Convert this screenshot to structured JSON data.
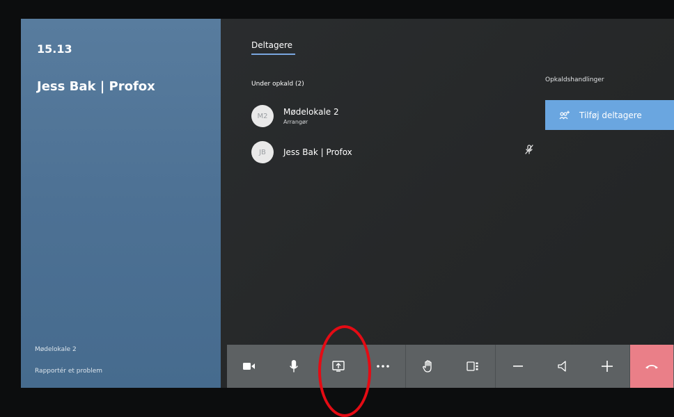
{
  "left_panel": {
    "time": "15.13",
    "meeting_title": "Jess Bak | Profox",
    "room_name": "Mødelokale 2",
    "report_link": "Rapportér et problem"
  },
  "main": {
    "tab_label": "Deltagere",
    "section_label": "Under opkald (2)",
    "actions_label": "Opkaldshandlinger",
    "add_participants_label": "Tilføj deltagere",
    "participants": [
      {
        "initials": "M2",
        "name": "Mødelokale 2",
        "role": "Arrangør"
      },
      {
        "initials": "JB",
        "name": "Jess Bak | Profox"
      }
    ]
  },
  "toolbar": {
    "buttons": [
      "camera-icon",
      "microphone-icon",
      "share-screen-icon",
      "more-icon",
      "raise-hand-icon",
      "layout-icon",
      "volume-down-icon",
      "speaker-icon",
      "volume-up-icon",
      "hang-up-icon"
    ]
  },
  "colors": {
    "accent": "#6aa6e0",
    "left_panel": "#4d7194",
    "end_call": "#ea7f88",
    "annotation": "#e40b14"
  }
}
